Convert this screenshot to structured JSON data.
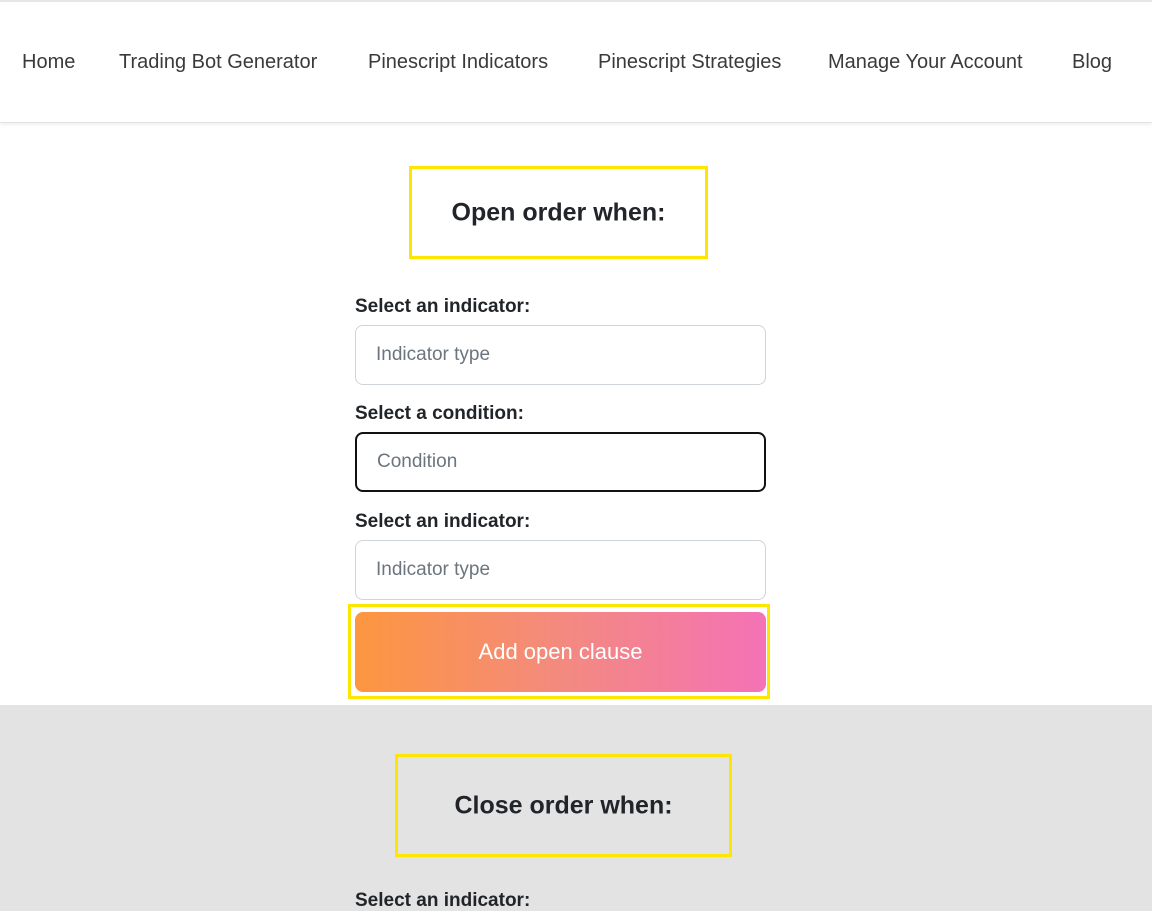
{
  "nav": {
    "items": [
      "Home",
      "Trading Bot Generator",
      "Pinescript Indicators",
      "Pinescript Strategies",
      "Manage Your Account",
      "Blog"
    ]
  },
  "open": {
    "title": "Open order when:",
    "indicator_label": "Select an indicator:",
    "indicator_placeholder": "Indicator type",
    "condition_label": "Select a condition:",
    "condition_placeholder": "Condition",
    "indicator2_label": "Select an indicator:",
    "indicator2_placeholder": "Indicator type",
    "add_button": "Add open clause"
  },
  "close": {
    "title": "Close order when:",
    "indicator_label": "Select an indicator:"
  },
  "colors": {
    "highlight": "#ffe600",
    "button_start": "#fd9640",
    "button_end": "#f472b6",
    "section_bg": "#e3e3e3"
  }
}
